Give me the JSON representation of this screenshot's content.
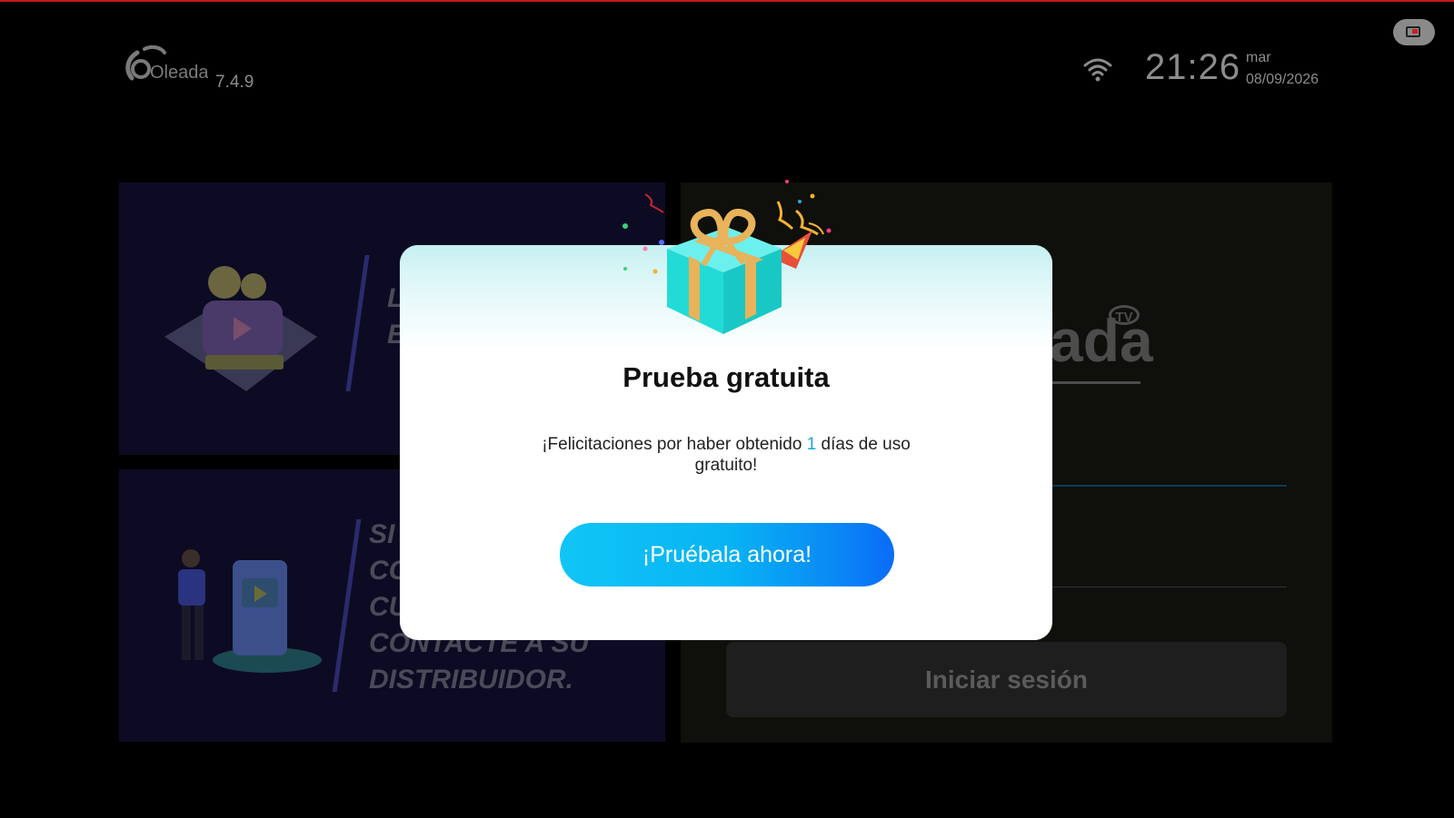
{
  "header": {
    "brand": "Oleada",
    "version": "7.4.9",
    "time": "21:26",
    "weekday": "mar",
    "date": "08/09/2026"
  },
  "background": {
    "promo_top_text": [
      "L",
      "E"
    ],
    "promo_bottom_text": [
      "SI",
      "CO",
      "CU",
      "CONTACTE A SU",
      "DISTRIBUIDOR."
    ],
    "right_brand": "ada",
    "right_brand_badge": "TV",
    "login_label": "Iniciar sesión"
  },
  "modal": {
    "title": "Prueba gratuita",
    "message_prefix": "¡Felicitaciones por haber obtenido ",
    "days": "1",
    "message_suffix": " días de uso gratuito!",
    "button_label": "¡Pruébala ahora!"
  },
  "icons": {
    "wifi": "wifi-icon",
    "cast": "cast-icon",
    "gift": "gift-icon"
  },
  "colors": {
    "accent": "#16a7d6",
    "button_start": "#10c5f6",
    "button_end": "#0a6cf7",
    "top_line": "#c21b1b"
  }
}
